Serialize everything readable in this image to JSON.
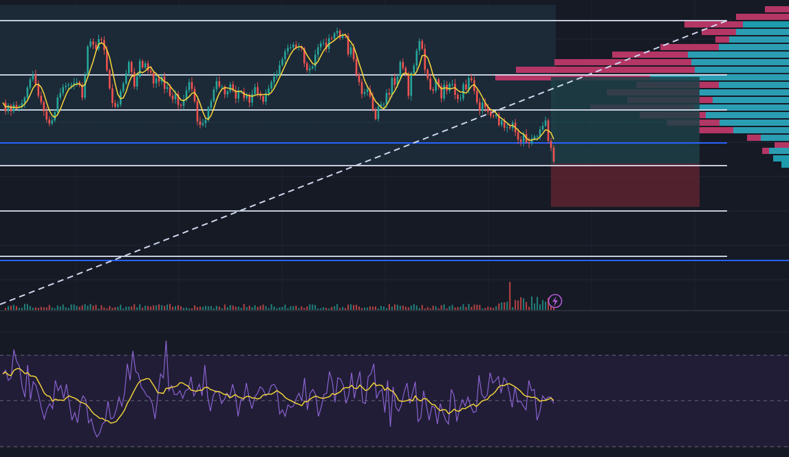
{
  "colors": {
    "background": "#161a25",
    "grid": "#232837",
    "range_box": "#1c2a38",
    "hline": "#dfe6f7",
    "hline_blue": "#2962ff",
    "trendline": "#cfd8ee",
    "candle_up": "#26a69a",
    "candle_down": "#ef5350",
    "ma": "#f0d23c",
    "target_zone": "#1d3f46",
    "stop_zone": "#5c2530",
    "vp_up": "#1fa6b8",
    "vp_down": "#c2386a",
    "osc_bg": "#211d36",
    "osc_line": "#8a63d2",
    "osc_signal": "#f0d23c",
    "osc_band": "#6d6780",
    "flash": "#b35ad6"
  },
  "icons": {
    "alert_badge": "lightning-icon"
  },
  "chart_data": [
    {
      "type": "line",
      "pane": "price",
      "x_bars": 200,
      "series": [
        {
          "values": [
            49,
            30,
            43,
            30,
            44,
            38,
            40,
            48,
            60,
            82,
            100,
            110,
            90,
            64,
            50,
            30,
            12,
            3,
            10,
            28,
            60,
            70,
            83,
            86,
            88,
            88,
            92,
            94,
            88,
            60,
            108,
            172,
            183,
            176,
            167,
            188,
            186,
            164,
            120,
            80,
            48,
            40,
            45,
            74,
            91,
            113,
            138,
            116,
            84,
            106,
            140,
            126,
            135,
            119,
            115,
            91,
            102,
            95,
            106,
            79,
            83,
            64,
            56,
            68,
            44,
            42,
            55,
            76,
            94,
            79,
            52,
            8,
            0,
            4,
            11,
            38,
            52,
            78,
            96,
            84,
            84,
            67,
            74,
            89,
            76,
            58,
            73,
            73,
            59,
            66,
            49,
            68,
            83,
            69,
            63,
            51,
            69,
            80,
            94,
            106,
            110,
            131,
            144,
            161,
            169,
            170,
            176,
            170,
            172,
            168,
            135,
            120,
            124,
            128,
            154,
            170,
            179,
            180,
            167,
            190,
            189,
            201,
            206,
            191,
            197,
            195,
            155,
            170,
            144,
            110,
            94,
            68,
            72,
            78,
            62,
            33,
            13,
            40,
            45,
            46,
            70,
            66,
            103,
            88,
            106,
            138,
            125,
            113,
            64,
            114,
            130,
            163,
            184,
            167,
            121,
            102,
            78,
            75,
            100,
            84,
            58,
            88,
            75,
            90,
            90,
            66,
            57,
            58,
            89,
            78,
            103,
            98,
            75,
            50,
            31,
            49,
            39,
            29,
            20,
            19,
            23,
            0,
            10,
            -6,
            -5,
            -7,
            5,
            -16,
            -32,
            -37,
            -20,
            -38,
            -40,
            -30,
            -25,
            -25,
            -10,
            -2,
            10,
            -35,
            -50,
            -80
          ]
        }
      ]
    },
    {
      "type": "line",
      "pane": "oscillator",
      "x_bars": 200,
      "series": [
        {
          "values": [
            63,
            66,
            58,
            60,
            82,
            73,
            69,
            53,
            45,
            70,
            43,
            57,
            54,
            46,
            36,
            28,
            36,
            40,
            36,
            58,
            50,
            54,
            44,
            55,
            41,
            27,
            33,
            25,
            40,
            46,
            43,
            25,
            28,
            19,
            14,
            17,
            24,
            26,
            42,
            28,
            29,
            35,
            45,
            38,
            48,
            71,
            58,
            81,
            65,
            63,
            53,
            50,
            46,
            45,
            40,
            28,
            46,
            63,
            60,
            89,
            50,
            54,
            47,
            47,
            50,
            44,
            50,
            51,
            61,
            46,
            50,
            55,
            46,
            70,
            45,
            34,
            46,
            50,
            49,
            40,
            43,
            48,
            45,
            55,
            47,
            30,
            43,
            43,
            56,
            44,
            36,
            45,
            48,
            53,
            51,
            46,
            48,
            54,
            55,
            51,
            32,
            35,
            30,
            39,
            37,
            38,
            44,
            48,
            42,
            60,
            35,
            48,
            51,
            47,
            30,
            37,
            47,
            48,
            65,
            57,
            41,
            60,
            59,
            54,
            40,
            47,
            64,
            44,
            56,
            65,
            41,
            40,
            61,
            63,
            71,
            44,
            49,
            51,
            33,
            58,
            22,
            53,
            37,
            34,
            39,
            49,
            56,
            40,
            48,
            57,
            26,
            29,
            50,
            39,
            27,
            38,
            37,
            24,
            40,
            33,
            27,
            24,
            51,
            46,
            26,
            36,
            43,
            38,
            45,
            38,
            33,
            34,
            62,
            47,
            44,
            47,
            64,
            56,
            58,
            61,
            48,
            60,
            57,
            48,
            37,
            53,
            41,
            42,
            38,
            35,
            58,
            50,
            51,
            27,
            34,
            46,
            43,
            45,
            45,
            40
          ]
        }
      ]
    }
  ]
}
